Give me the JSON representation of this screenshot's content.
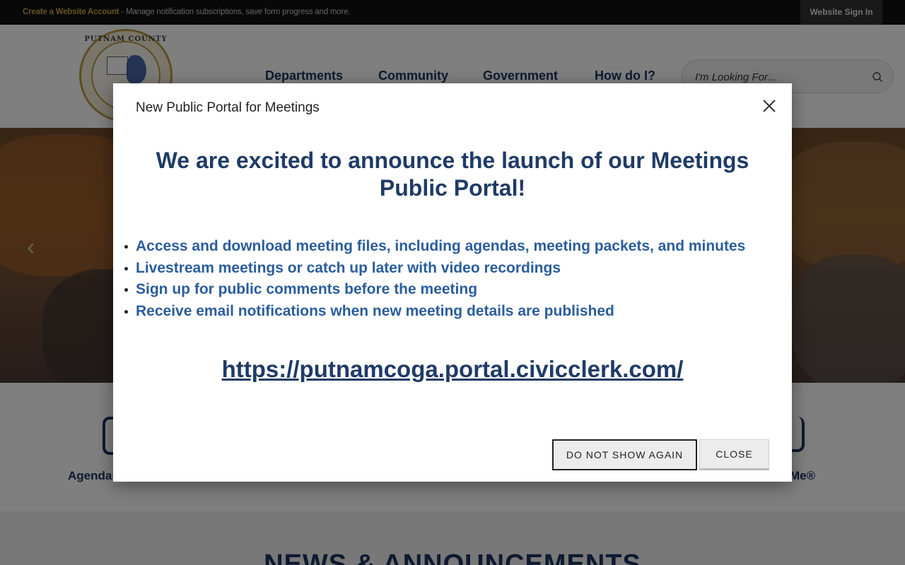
{
  "topbar": {
    "create_account_link": "Create a Website Account",
    "create_account_desc": " - Manage notification subscriptions, save form progress and more.",
    "sign_in": "Website Sign In"
  },
  "header": {
    "seal_text": "PUTNAM COUNTY",
    "nav": [
      "Departments",
      "Community",
      "Government",
      "How do I?"
    ],
    "search_placeholder": "I'm Looking For...",
    "search_icon": "search-icon"
  },
  "quick_links": {
    "left_label": "Agendas",
    "right_label": "Me®"
  },
  "news": {
    "heading": "NEWS & ANNOUNCEMENTS"
  },
  "modal": {
    "title": "New Public Portal for Meetings",
    "headline": "We are excited to announce the launch of our Meetings Public Portal!",
    "bullets": [
      "Access and download meeting files, including agendas, meeting packets, and minutes",
      "Livestream meetings or catch up later with video recordings",
      "Sign up for public comments before the meeting",
      "Receive email notifications when new meeting details are published"
    ],
    "portal_link": "https://putnamcoga.portal.civicclerk.com/",
    "do_not_show_label": "DO NOT SHOW AGAIN",
    "close_label": "CLOSE",
    "close_icon": "close-icon"
  },
  "colors": {
    "navy": "#1c3560",
    "bullet_blue": "#2a5d9c",
    "gold": "#c9a548"
  }
}
